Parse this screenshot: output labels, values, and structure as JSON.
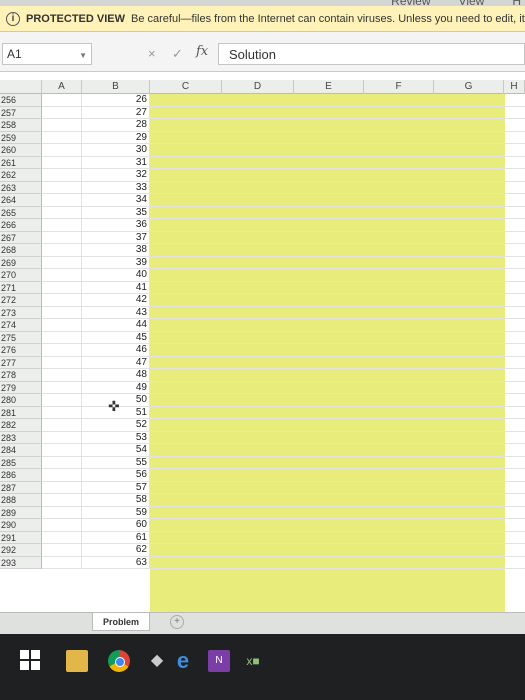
{
  "ribbon": {
    "tabs": [
      "Review",
      "View",
      "H"
    ]
  },
  "protected_view": {
    "icon": "info-icon",
    "title": "PROTECTED VIEW",
    "message": "Be careful—files from the Internet can contain viruses. Unless you need to edit, it'"
  },
  "formula_bar": {
    "name_box": "A1",
    "cancel_icon": "×",
    "enter_icon": "✓",
    "fx_label": "fx",
    "formula_value": "Solution"
  },
  "columns": [
    "A",
    "B",
    "C",
    "D",
    "E",
    "F",
    "G",
    "H"
  ],
  "rows": [
    {
      "num": "256",
      "b": "26"
    },
    {
      "num": "257",
      "b": "27"
    },
    {
      "num": "258",
      "b": "28"
    },
    {
      "num": "259",
      "b": "29"
    },
    {
      "num": "260",
      "b": "30"
    },
    {
      "num": "261",
      "b": "31"
    },
    {
      "num": "262",
      "b": "32"
    },
    {
      "num": "263",
      "b": "33"
    },
    {
      "num": "264",
      "b": "34"
    },
    {
      "num": "265",
      "b": "35"
    },
    {
      "num": "266",
      "b": "36"
    },
    {
      "num": "267",
      "b": "37"
    },
    {
      "num": "268",
      "b": "38"
    },
    {
      "num": "269",
      "b": "39"
    },
    {
      "num": "270",
      "b": "40"
    },
    {
      "num": "271",
      "b": "41"
    },
    {
      "num": "272",
      "b": "42"
    },
    {
      "num": "273",
      "b": "43"
    },
    {
      "num": "274",
      "b": "44"
    },
    {
      "num": "275",
      "b": "45"
    },
    {
      "num": "276",
      "b": "46"
    },
    {
      "num": "277",
      "b": "47"
    },
    {
      "num": "278",
      "b": "48"
    },
    {
      "num": "279",
      "b": "49"
    },
    {
      "num": "280",
      "b": "50"
    },
    {
      "num": "281",
      "b": "51"
    },
    {
      "num": "282",
      "b": "52"
    },
    {
      "num": "283",
      "b": "53"
    },
    {
      "num": "284",
      "b": "54"
    },
    {
      "num": "285",
      "b": "55"
    },
    {
      "num": "286",
      "b": "56"
    },
    {
      "num": "287",
      "b": "57"
    },
    {
      "num": "288",
      "b": "58"
    },
    {
      "num": "289",
      "b": "59"
    },
    {
      "num": "290",
      "b": "60"
    },
    {
      "num": "291",
      "b": "61"
    },
    {
      "num": "292",
      "b": "62"
    },
    {
      "num": "293",
      "b": "63"
    }
  ],
  "fill_color": "#e8ec7a",
  "sheet_tabs": {
    "active": "Problem",
    "add_icon": "+"
  },
  "taskbar": {
    "icons": [
      "windows-start-icon",
      "file-explorer-icon",
      "chrome-icon",
      "media-icon",
      "edge-icon",
      "onenote-icon",
      "excel-icon"
    ],
    "edge_glyph": "e",
    "onenote_glyph": "N",
    "excel_glyph": "x■"
  }
}
